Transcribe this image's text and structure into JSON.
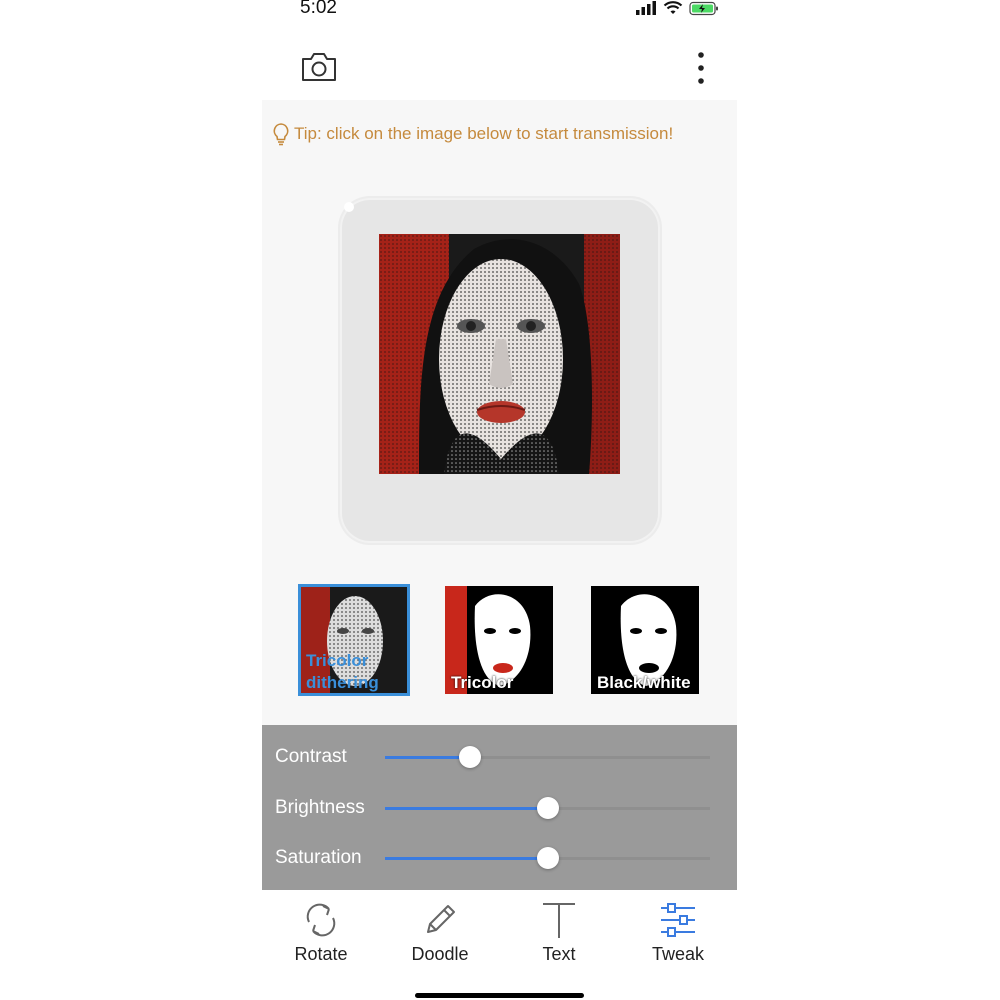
{
  "status": {
    "time": "5:02"
  },
  "tip": {
    "text": "Tip: click on the image below to start transmission!"
  },
  "modes": [
    {
      "label": "Tricolor dithering",
      "selected": true
    },
    {
      "label": "Tricolor",
      "selected": false
    },
    {
      "label": "Black/white",
      "selected": false
    }
  ],
  "sliders": [
    {
      "label": "Contrast",
      "value": 0.26
    },
    {
      "label": "Brightness",
      "value": 0.5
    },
    {
      "label": "Saturation",
      "value": 0.5
    }
  ],
  "nav": [
    {
      "label": "Rotate",
      "icon": "rotate-icon"
    },
    {
      "label": "Doodle",
      "icon": "pencil-icon"
    },
    {
      "label": "Text",
      "icon": "text-icon"
    },
    {
      "label": "Tweak",
      "icon": "sliders-icon",
      "active": true
    }
  ],
  "colors": {
    "accent": "#3a7be0",
    "tip": "#c58a3d",
    "panel": "#9a9a9a"
  }
}
